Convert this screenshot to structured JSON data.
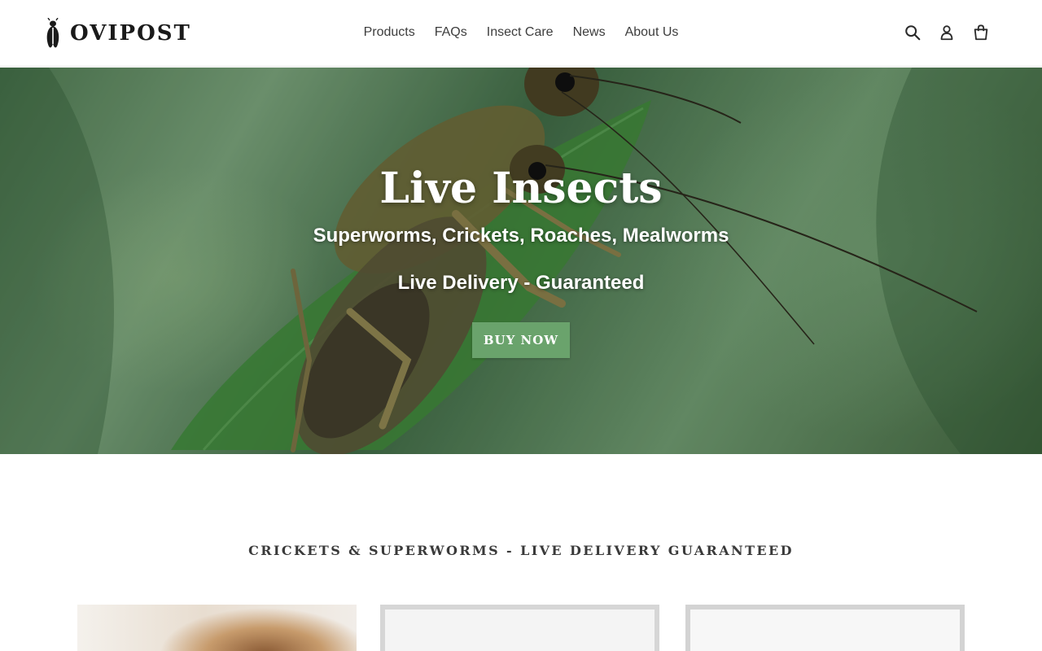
{
  "brand": {
    "name": "OVIPOST"
  },
  "nav": {
    "items": [
      {
        "label": "Products"
      },
      {
        "label": "FAQs"
      },
      {
        "label": "Insect Care"
      },
      {
        "label": "News"
      },
      {
        "label": "About Us"
      }
    ]
  },
  "header_icons": {
    "search": "search-icon",
    "account": "account-icon",
    "cart": "cart-icon"
  },
  "hero": {
    "title": "Live Insects",
    "subtitle": "Superworms, Crickets, Roaches, Mealworms",
    "tagline": "Live Delivery - Guaranteed",
    "button_label": "BUY NOW"
  },
  "collection": {
    "heading": "CRICKETS & SUPERWORMS - LIVE DELIVERY GUARANTEED"
  },
  "colors": {
    "accent": "#6aa36c",
    "text": "#3a3a3a",
    "header_bg": "#ffffff"
  }
}
